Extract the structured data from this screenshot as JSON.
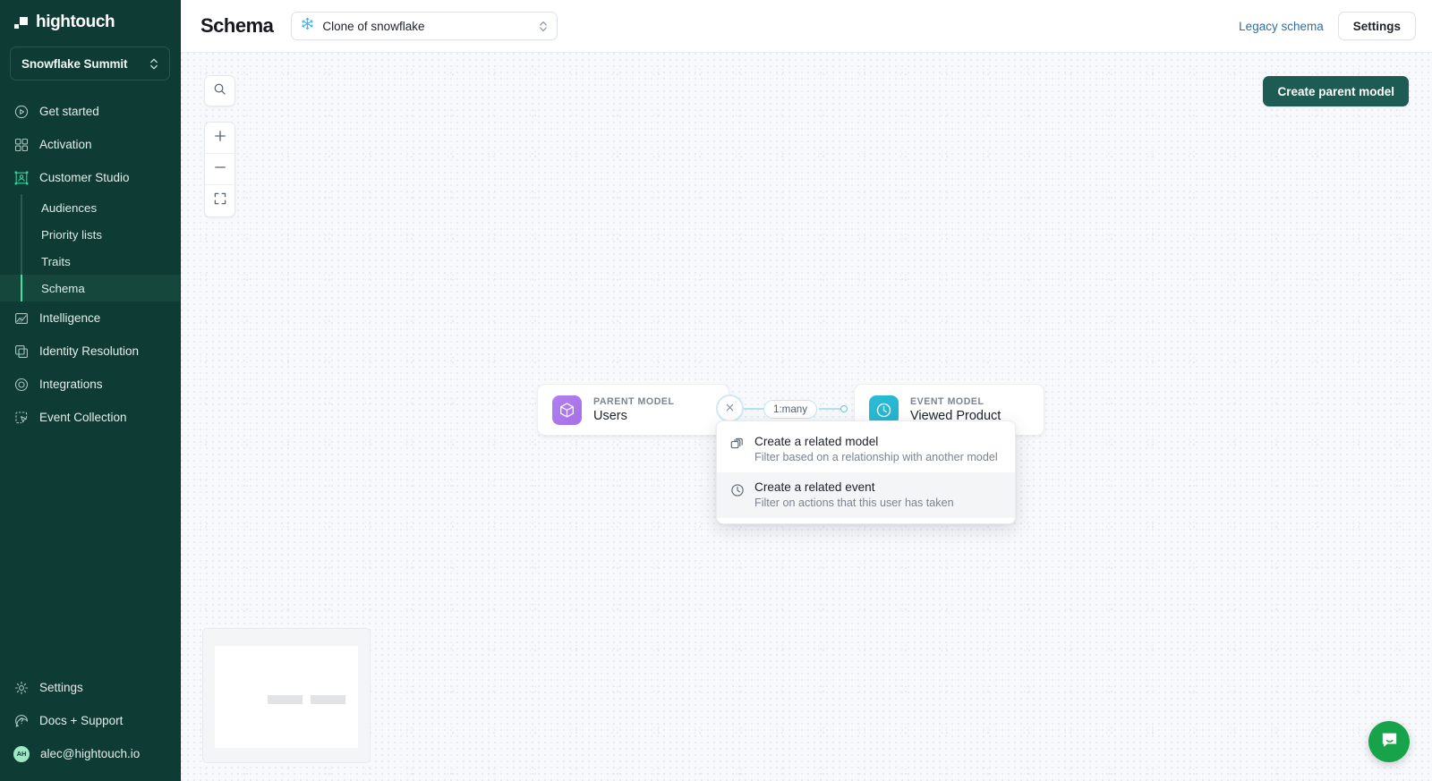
{
  "brand": {
    "name": "hightouch",
    "logo_icon": "hightouch-logo-icon",
    "sidebar_color": "#0e3b33",
    "accent_green": "#3ee49f",
    "primary_button": "#1d5c52"
  },
  "sidebar": {
    "workspace": {
      "name": "Snowflake Summit",
      "chevron_icon": "updown-chevron-icon"
    },
    "items": [
      {
        "label": "Get started",
        "icon": "play-circle-icon",
        "active": false
      },
      {
        "label": "Activation",
        "icon": "grid-blocks-icon",
        "active": false
      },
      {
        "label": "Customer Studio",
        "icon": "customer-studio-icon",
        "active": true
      }
    ],
    "sub_items": [
      {
        "label": "Audiences",
        "active": false
      },
      {
        "label": "Priority lists",
        "active": false
      },
      {
        "label": "Traits",
        "active": false
      },
      {
        "label": "Schema",
        "active": true
      }
    ],
    "items_after": [
      {
        "label": "Intelligence",
        "icon": "chart-area-icon"
      },
      {
        "label": "Identity Resolution",
        "icon": "layers-identity-icon"
      },
      {
        "label": "Integrations",
        "icon": "circle-orbit-icon"
      },
      {
        "label": "Event Collection",
        "icon": "cursor-box-icon"
      }
    ],
    "bottom_items": [
      {
        "label": "Settings",
        "icon": "gear-icon"
      },
      {
        "label": "Docs + Support",
        "icon": "question-circle-icon"
      }
    ],
    "account": {
      "email": "alec@hightouch.io",
      "initials": "AH",
      "avatar_icon": "avatar"
    }
  },
  "topbar": {
    "title": "Schema",
    "model_select": {
      "value": "Clone of snowflake",
      "icon": "snowflake-icon",
      "chevron_icon": "updown-chevron-icon"
    },
    "legacy_schema_link": "Legacy schema",
    "settings_button": "Settings"
  },
  "canvas": {
    "controls": {
      "search_icon": "search-icon",
      "zoom_in_icon": "plus-icon",
      "zoom_out_icon": "minus-icon",
      "fit_view_icon": "fit-screen-icon"
    },
    "create_parent_model_button": "Create parent model",
    "nodes": [
      {
        "kicker": "PARENT MODEL",
        "name": "Users",
        "icon": "cube-icon",
        "color": "#ae77ec"
      },
      {
        "kicker": "EVENT MODEL",
        "name": "Viewed Product",
        "icon": "clock-icon",
        "color": "#27b7d2"
      }
    ],
    "edge": {
      "cardinality_label": "1:many",
      "remove_icon": "close-x-icon",
      "endpoint_icon": "edge-endpoint-dot"
    },
    "context_menu": [
      {
        "title": "Create a related model",
        "subtitle": "Filter based on a relationship with another model",
        "icon": "stacked-models-icon",
        "hovered": false
      },
      {
        "title": "Create a related event",
        "subtitle": "Filter on actions that this user has taken",
        "icon": "clock-icon",
        "hovered": true
      }
    ],
    "minimap_icon": "minimap",
    "support_bubble_icon": "chat-bubble-icon"
  }
}
